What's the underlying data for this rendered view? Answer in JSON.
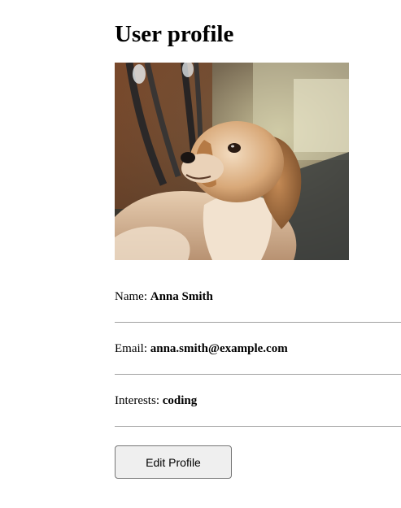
{
  "page": {
    "title": "User profile"
  },
  "profile": {
    "photo_icon": "dog-photo",
    "fields": [
      {
        "label": "Name: ",
        "value": "Anna Smith"
      },
      {
        "label": "Email: ",
        "value": "anna.smith@example.com"
      },
      {
        "label": "Interests: ",
        "value": "coding"
      }
    ]
  },
  "actions": {
    "edit_label": "Edit Profile"
  }
}
